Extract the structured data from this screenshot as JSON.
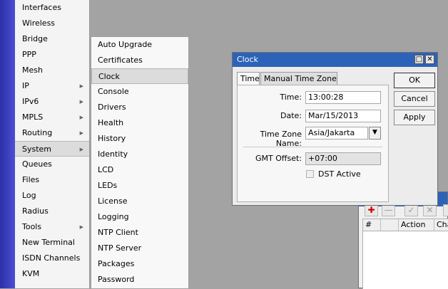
{
  "main_menu": [
    {
      "label": "Interfaces",
      "submenu": false
    },
    {
      "label": "Wireless",
      "submenu": false
    },
    {
      "label": "Bridge",
      "submenu": false
    },
    {
      "label": "PPP",
      "submenu": false
    },
    {
      "label": "Mesh",
      "submenu": false
    },
    {
      "label": "IP",
      "submenu": true
    },
    {
      "label": "IPv6",
      "submenu": true
    },
    {
      "label": "MPLS",
      "submenu": true
    },
    {
      "label": "Routing",
      "submenu": true
    },
    {
      "label": "System",
      "submenu": true,
      "selected": true
    },
    {
      "label": "Queues",
      "submenu": false
    },
    {
      "label": "Files",
      "submenu": false
    },
    {
      "label": "Log",
      "submenu": false
    },
    {
      "label": "Radius",
      "submenu": false
    },
    {
      "label": "Tools",
      "submenu": true
    },
    {
      "label": "New Terminal",
      "submenu": false
    },
    {
      "label": "ISDN Channels",
      "submenu": false
    },
    {
      "label": "KVM",
      "submenu": false
    }
  ],
  "system_submenu": [
    {
      "label": "Auto Upgrade"
    },
    {
      "label": "Certificates"
    },
    {
      "label": "Clock",
      "selected": true
    },
    {
      "label": "Console"
    },
    {
      "label": "Drivers"
    },
    {
      "label": "Health"
    },
    {
      "label": "History"
    },
    {
      "label": "Identity"
    },
    {
      "label": "LCD"
    },
    {
      "label": "LEDs"
    },
    {
      "label": "License"
    },
    {
      "label": "Logging"
    },
    {
      "label": "NTP Client"
    },
    {
      "label": "NTP Server"
    },
    {
      "label": "Packages"
    },
    {
      "label": "Password"
    }
  ],
  "clock_window": {
    "title": "Clock",
    "tabs": [
      "Time",
      "Manual Time Zone"
    ],
    "time_label": "Time:",
    "time_value": "13:00:28",
    "date_label": "Date:",
    "date_value": "Mar/15/2013",
    "tz_label": "Time Zone Name:",
    "tz_value": "Asia/Jakarta",
    "gmt_label": "GMT Offset:",
    "gmt_value": "+07:00",
    "dst_label": "DST Active",
    "ok_label": "OK",
    "cancel_label": "Cancel",
    "apply_label": "Apply"
  },
  "back_window": {
    "col_hash": "#",
    "col_action": "Action",
    "col_cha": "Cha"
  },
  "colors": {
    "titlebar": "#2c63b8",
    "sidebar_strip": "#3a3fc0"
  }
}
